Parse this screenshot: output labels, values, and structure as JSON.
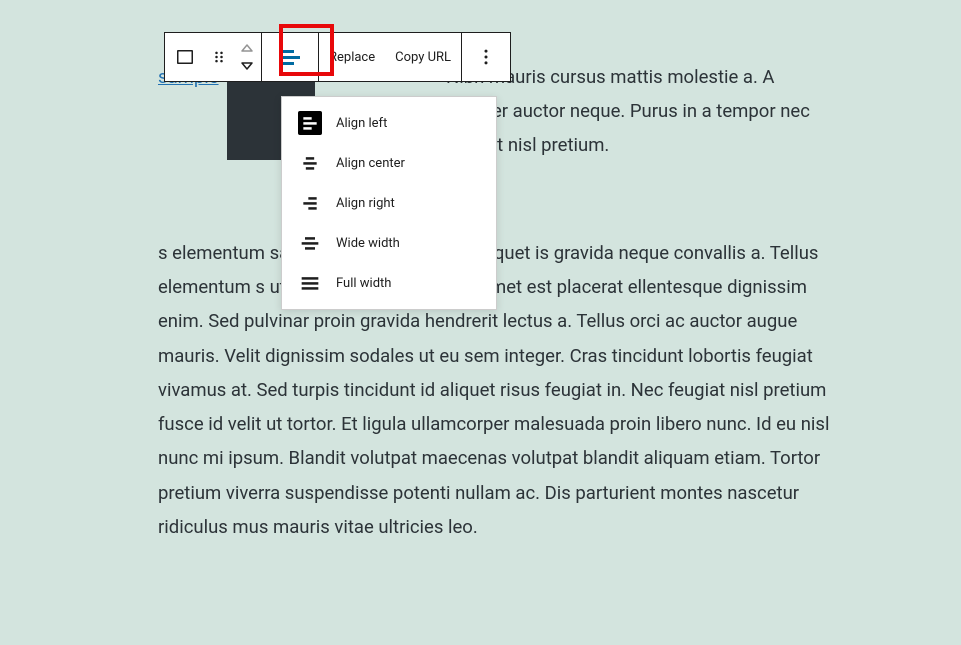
{
  "toolbar": {
    "replace_label": "Replace",
    "copy_url_label": "Copy URL"
  },
  "alignment_menu": {
    "items": [
      {
        "label": "Align left",
        "active": true
      },
      {
        "label": "Align center",
        "active": false
      },
      {
        "label": "Align right",
        "active": false
      },
      {
        "label": "Wide width",
        "active": false
      },
      {
        "label": "Full width",
        "active": false
      }
    ]
  },
  "content": {
    "file_link_text": "sample",
    "intro_fragment": "Nibh mauris cursus mattis molestie a. A semper auctor neque. Purus in a tempor nec feugiat nisl pretium.",
    "main_paragraph": "s elementum sagittis vitae et leo duis. Aliquet is gravida neque convallis a. Tellus elementum s ut diam. Ornare lectus sit amet est placerat ellentesque dignissim enim. Sed pulvinar proin gravida hendrerit lectus a. Tellus orci ac auctor augue mauris. Velit dignissim sodales ut eu sem integer. Cras tincidunt lobortis feugiat vivamus at. Sed turpis tincidunt id aliquet risus feugiat in. Nec feugiat nisl pretium fusce id velit ut tortor. Et ligula ullamcorper malesuada proin libero nunc. Id eu nisl nunc mi ipsum. Blandit volutpat maecenas volutpat blandit aliquam etiam. Tortor pretium viverra suspendisse potenti nullam ac. Dis parturient montes nascetur ridiculus mus mauris vitae ultricies leo."
  },
  "colors": {
    "background": "#d3e4de",
    "text": "#2c3338",
    "link": "#2271b1",
    "highlight": "#e8080a",
    "align_active": "#006ba1"
  }
}
